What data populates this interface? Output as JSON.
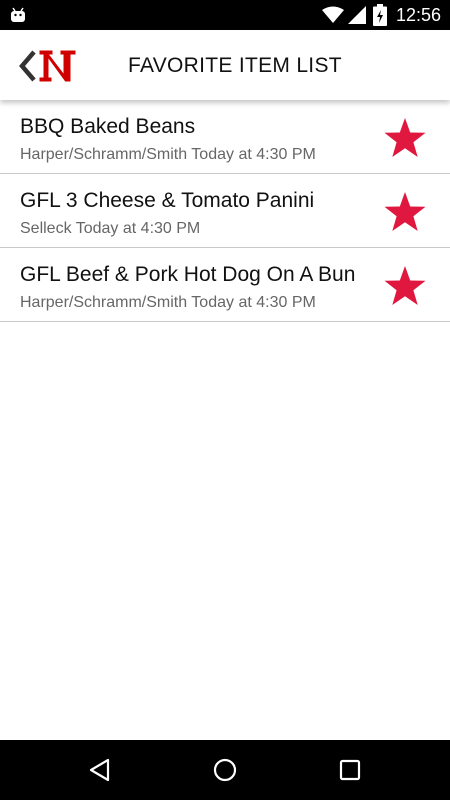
{
  "status_bar": {
    "time": "12:56",
    "icons": [
      "android-icon",
      "wifi-icon",
      "signal-icon",
      "battery-icon"
    ]
  },
  "app_bar": {
    "title": "FAVORITE ITEM LIST",
    "back_icon": "chevron-left-icon",
    "logo": "N",
    "brand_color": "#d00000"
  },
  "favorites": [
    {
      "name": "BBQ Baked Beans",
      "detail": "Harper/Schramm/Smith Today at 4:30 PM",
      "starred": true
    },
    {
      "name": "GFL 3 Cheese & Tomato Panini",
      "detail": "Selleck Today at 4:30 PM",
      "starred": true
    },
    {
      "name": "GFL Beef & Pork Hot Dog On A Bun",
      "detail": "Harper/Schramm/Smith Today at 4:30 PM",
      "starred": true
    }
  ],
  "star_color": "#e0173f",
  "nav_bar": {
    "icons": [
      "back-triangle-icon",
      "home-circle-icon",
      "recents-square-icon"
    ]
  }
}
